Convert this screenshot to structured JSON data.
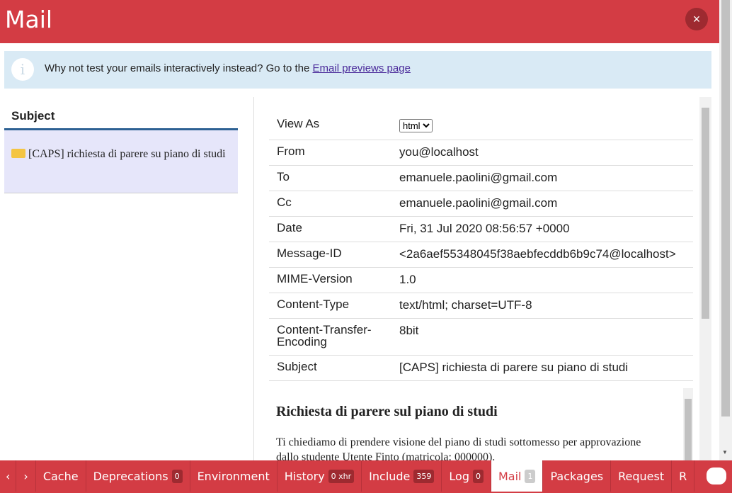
{
  "header": {
    "title": "Mail",
    "close": "×"
  },
  "info": {
    "icon": "info-icon",
    "text": "Why not test your emails interactively instead? Go to the ",
    "link": "Email previews page"
  },
  "list": {
    "header": "Subject",
    "items": [
      {
        "subject": "[CAPS] richiesta di parere su piano di studi"
      }
    ]
  },
  "details": {
    "view_as_label": "View As",
    "view_as_value": "html",
    "rows": [
      {
        "k": "From",
        "v": "you@localhost"
      },
      {
        "k": "To",
        "v": "emanuele.paolini@gmail.com"
      },
      {
        "k": "Cc",
        "v": "emanuele.paolini@gmail.com"
      },
      {
        "k": "Date",
        "v": "Fri, 31 Jul 2020 08:56:57 +0000"
      },
      {
        "k": "Message-ID",
        "v": "<2a6aef55348045f38aebfecddb6b9c74@localhost>"
      },
      {
        "k": "MIME-Version",
        "v": "1.0"
      },
      {
        "k": "Content-Type",
        "v": "text/html; charset=UTF-8"
      },
      {
        "k": "Content-Transfer-Encoding",
        "v": "8bit"
      },
      {
        "k": "Subject",
        "v": "[CAPS] richiesta di parere su piano di studi"
      }
    ]
  },
  "preview": {
    "heading": "Richiesta di parere sul piano di studi",
    "body": "Ti chiediamo di prendere visione del piano di studi sottomesso per approvazione dallo studente Utente Finto (matricola: 000000)."
  },
  "toolbar": {
    "prev": "‹",
    "next": "›",
    "tabs": [
      {
        "label": "Cache"
      },
      {
        "label": "Deprecations",
        "badge": "0"
      },
      {
        "label": "Environment"
      },
      {
        "label": "History",
        "badge": "0 xhr"
      },
      {
        "label": "Include",
        "badge": "359"
      },
      {
        "label": "Log",
        "badge": "0"
      },
      {
        "label": "Mail",
        "badge": "1",
        "active": true
      },
      {
        "label": "Packages"
      },
      {
        "label": "Request"
      },
      {
        "label": "R"
      }
    ]
  }
}
